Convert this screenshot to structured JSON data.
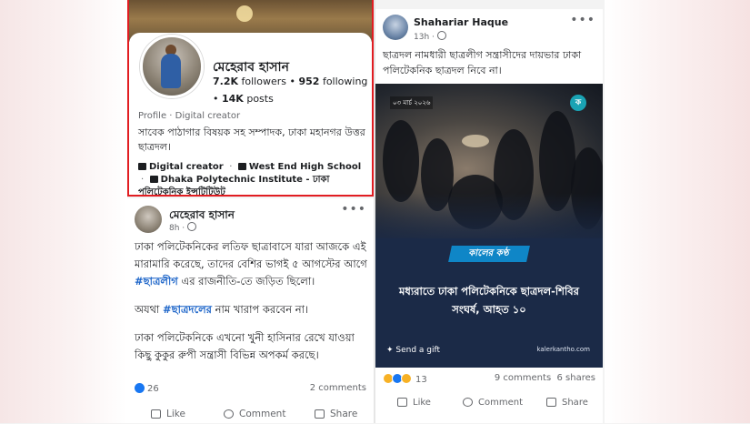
{
  "profile": {
    "name": "মেহেরাব হাসান",
    "followers": "7.2K",
    "followers_label": "followers",
    "following": "952",
    "following_label": "following",
    "posts": "14K",
    "posts_label": "posts",
    "meta": "Profile · Digital creator",
    "bio": "সাবেক পাঠাগার বিষয়ক সহ সম্পাদক, ঢাকা মহানগর উত্তর ছাত্রদল।",
    "info_creator": "Digital creator",
    "info_school": "West End High School",
    "info_college": "Dhaka Polytechnic Institute - ঢাকা পলিটেকনিক ইন্সটিটিউট",
    "highlight_color": "#e11d22"
  },
  "post_left": {
    "author": "মেহেরাব হাসান",
    "time": "8h ·",
    "more": "•••",
    "para1_pre": "ঢাকা পলিটেকনিকের লতিফ ছাত্রাবাসে যারা আজকে এই মারামারি করেছে, তাদের বেশির ভাগই ৫ আগস্টের আগে ",
    "para1_tag": "#ছাত্রলীগ",
    "para1_post": " এর রাজনীতি-তে জড়িত ছিলো।",
    "para2_pre": "অযথা ",
    "para2_tag": "#ছাত্রদলের",
    "para2_post": " নাম খারাপ করবেন না।",
    "para3": "ঢাকা পলিটেকনিকে এখনো খুনী হাসিনার রেখে যাওয়া কিছু কুকুর রুপী সন্ত্রাসী বিভিন্ন অপকর্ম করছে।",
    "reactions": "26",
    "comments": "2 comments",
    "actions": {
      "like": "Like",
      "comment": "Comment",
      "share": "Share"
    }
  },
  "post_right": {
    "author": "Shahariar Haque",
    "time": "13h ·",
    "more": "•••",
    "text": "ছাত্রদল নামধারী ছাত্রলীগ সন্ত্রাসীদের দায়ভার ঢাকা পলিটেকনিক ছাত্রদল নিবে না।",
    "media": {
      "date": "০৩ মার্চ ২০২৬",
      "brand": "কালের কণ্ঠ",
      "headline": "মধ্যরাতে ঢাকা পলিটেকনিকে ছাত্রদল-শিবির সংঘর্ষ, আহত ১০",
      "gift": "Send a gift",
      "site": "kalerkantho.com"
    },
    "reactions": "13",
    "comments": "9 comments",
    "shares": "6 shares",
    "actions": {
      "like": "Like",
      "comment": "Comment",
      "share": "Share"
    }
  }
}
